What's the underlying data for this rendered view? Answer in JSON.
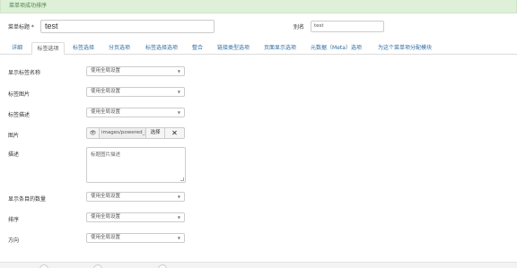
{
  "alert": {
    "text": "菜单项成功排序"
  },
  "form": {
    "title_label": "菜单标题 *",
    "title_value": "test",
    "alias_label": "别名",
    "alias_value": "test"
  },
  "tabs": [
    {
      "label": "详细",
      "active": false
    },
    {
      "label": "标签选项",
      "active": true
    },
    {
      "label": "标签选择",
      "active": false
    },
    {
      "label": "分页选项",
      "active": false
    },
    {
      "label": "标签选择选项",
      "active": false
    },
    {
      "label": "整合",
      "active": false
    },
    {
      "label": "链接类型选项",
      "active": false
    },
    {
      "label": "页面显示选项",
      "active": false
    },
    {
      "label": "元数据（Meta）选项",
      "active": false
    },
    {
      "label": "为这个菜单项分配模块",
      "active": false
    }
  ],
  "rows": {
    "show_tag_name": {
      "label": "显示标签名称",
      "value": "使用全局设置"
    },
    "tag_image": {
      "label": "标签图片",
      "value": "使用全局设置"
    },
    "tag_description": {
      "label": "标签描述",
      "value": "使用全局设置"
    },
    "image": {
      "label": "图片",
      "path": "images/powered_by.png",
      "choose_label": "选择",
      "clear_symbol": "✕",
      "preview_symbol": "👁"
    },
    "description": {
      "label": "描述",
      "placeholder": "标题图片描述"
    },
    "item_count": {
      "label": "显示条目的数量",
      "value": "使用全局设置"
    },
    "ordering": {
      "label": "排序",
      "value": "使用全局设置"
    },
    "direction": {
      "label": "方向",
      "value": "使用全局设置"
    }
  },
  "colors": {
    "link": "#2d6ca2",
    "alert_bg": "#dff0d8",
    "alert_text": "#468847",
    "border": "#cccccc"
  }
}
